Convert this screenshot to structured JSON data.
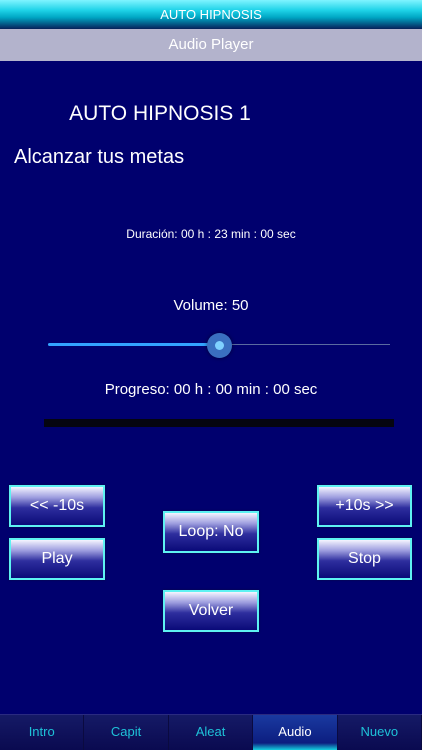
{
  "status_bar": {
    "title": "AUTO HIPNOSIS"
  },
  "nav_bar": {
    "title": "Audio Player"
  },
  "track": {
    "title": "AUTO HIPNOSIS 1",
    "subtitle": "Alcanzar tus metas"
  },
  "duration": {
    "text": "Duración:  00 h : 23 min : 00 sec"
  },
  "volume": {
    "label": "Volume: 50",
    "value": 50,
    "max": 100
  },
  "progress": {
    "label": "Progreso: 00 h : 00 min : 00 sec",
    "fraction": 0
  },
  "buttons": {
    "rewind": "<< -10s",
    "forward": "+10s >>",
    "loop": "Loop: No",
    "play": "Play",
    "stop": "Stop",
    "back": "Volver"
  },
  "tabs": [
    {
      "label": "Intro",
      "active": false
    },
    {
      "label": "Capit",
      "active": false
    },
    {
      "label": "Aleat",
      "active": false
    },
    {
      "label": "Audio",
      "active": true
    },
    {
      "label": "Nuevo",
      "active": false
    }
  ],
  "colors": {
    "background": "#00006e",
    "accent_cyan": "#5ef2f2",
    "slider_fill": "#33a3ff"
  }
}
